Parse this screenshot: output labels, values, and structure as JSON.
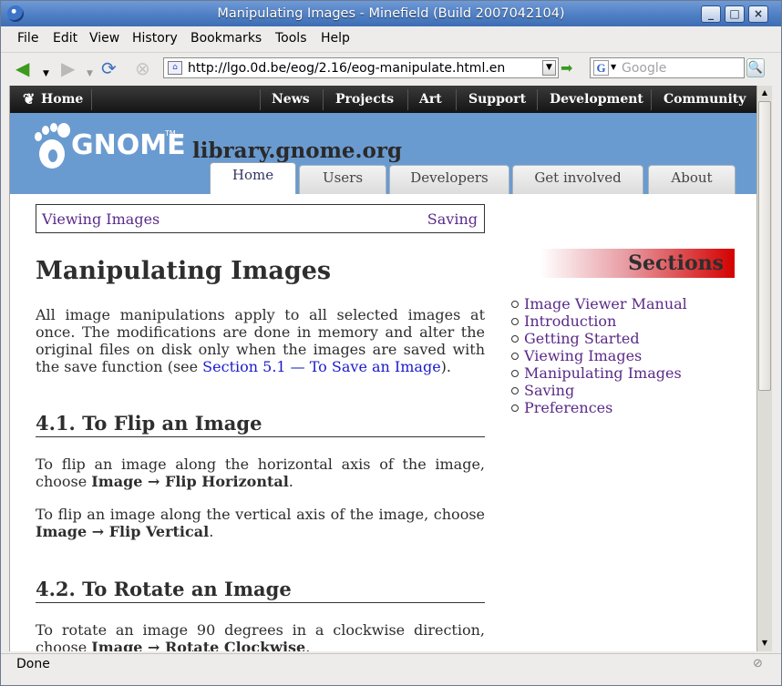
{
  "window": {
    "title": "Manipulating Images - Minefield (Build 2007042104)",
    "buttons": {
      "minimize": "_",
      "maximize": "□",
      "close": "×"
    }
  },
  "menu": [
    "File",
    "Edit",
    "View",
    "History",
    "Bookmarks",
    "Tools",
    "Help"
  ],
  "toolbar": {
    "url": "http://lgo.0d.be/eog/2.16/eog-manipulate.html.en",
    "search_placeholder": "Google",
    "search_engine_letter": "G"
  },
  "status": {
    "text": "Done"
  },
  "page": {
    "topnav": {
      "home": "Home",
      "items": [
        "News",
        "Projects",
        "Art",
        "Support",
        "Development",
        "Community"
      ]
    },
    "logo_text": "GNOME",
    "logo_tm": "TM",
    "site_title": "library.gnome.org",
    "tabs": [
      "Home",
      "Users",
      "Developers",
      "Get involved",
      "About"
    ],
    "active_tab": "Home",
    "breadcrumb": {
      "prev": "Viewing Images",
      "next": "Saving"
    },
    "title": "Manipulating Images",
    "intro": {
      "text": "All image manipulations apply to all selected images at once. The modifications are done in memory and alter the original files on disk only when the images are saved with the save function (see ",
      "link": "Section 5.1 — To Save an Image",
      "end": ")."
    },
    "section1": {
      "heading": "4.1.   To Flip an Image",
      "p1_text": "To flip an image along the horizontal axis of the image, choose ",
      "p1_menu": "Image → Flip Horizontal",
      "p1_end": ".",
      "p2_text": "To flip an image along the vertical axis of the image, choose ",
      "p2_menu": "Image → Flip Vertical",
      "p2_end": "."
    },
    "section2": {
      "heading": "4.2.   To Rotate an Image",
      "p1_text": "To rotate an image 90 degrees in a clockwise direction, choose ",
      "p1_menu": "Image → Rotate Clockwise",
      "p1_end": "."
    },
    "sidebar": {
      "heading": "Sections",
      "items": [
        "Image Viewer Manual",
        "Introduction",
        "Getting Started",
        "Viewing Images",
        "Manipulating Images",
        "Saving",
        "Preferences"
      ]
    }
  },
  "colors": {
    "titlebar": "#4f7fc4",
    "header": "#6a9bd0",
    "link_visited": "#5a2a88",
    "link": "#1a1acc",
    "sections_accent": "#d40000"
  }
}
